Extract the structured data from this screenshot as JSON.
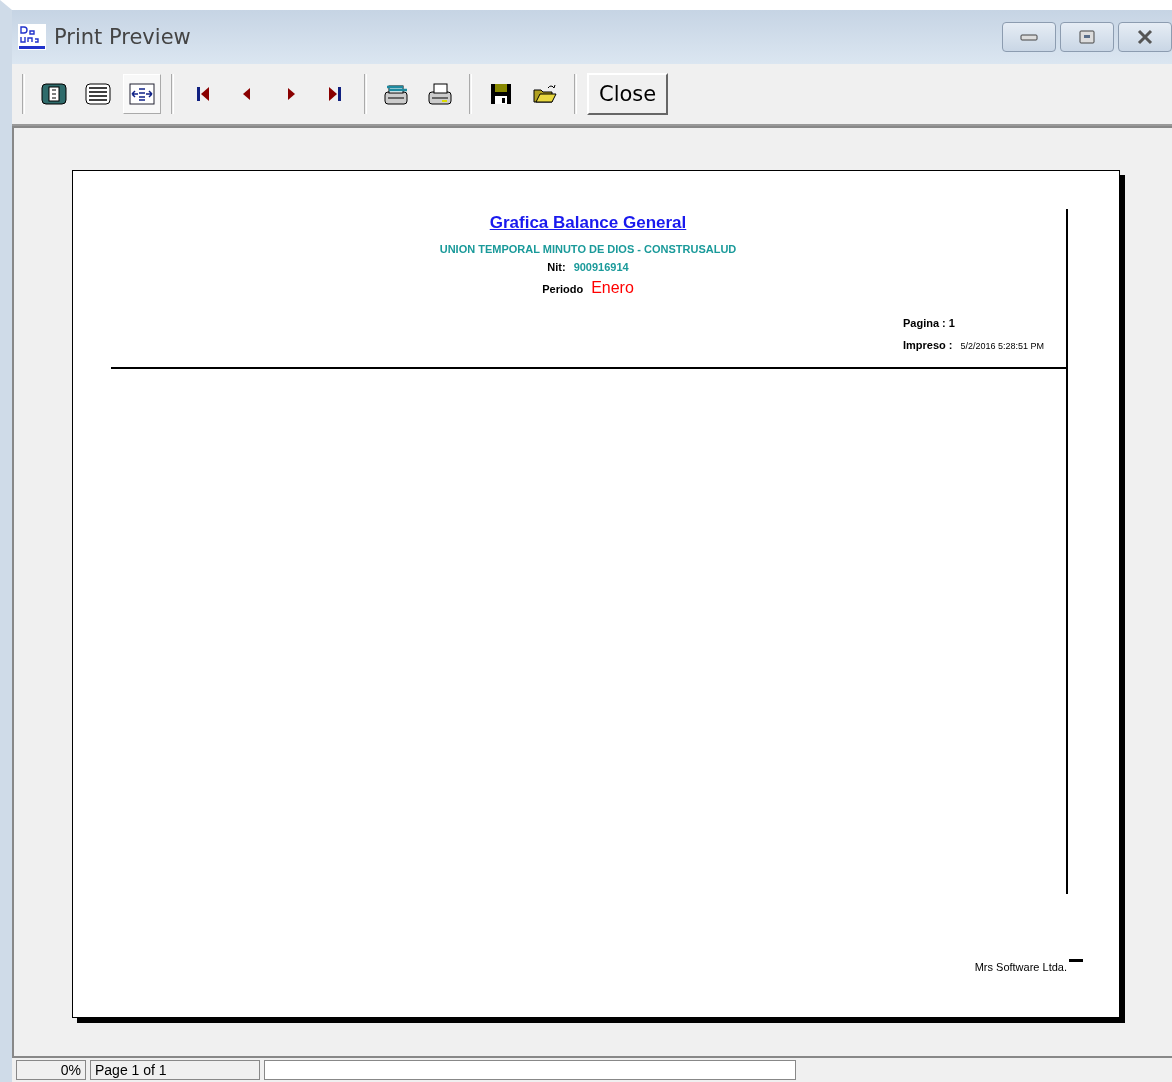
{
  "window": {
    "title": "Print Preview"
  },
  "toolbar": [
    {
      "kind": "icon",
      "selected": false
    },
    {
      "kind": "icon",
      "selected": false
    },
    {
      "kind": "icon",
      "selected": true
    },
    {
      "kind": "sep"
    },
    {
      "kind": "icon"
    },
    {
      "kind": "icon"
    },
    {
      "kind": "icon"
    },
    {
      "kind": "icon"
    },
    {
      "kind": "sep"
    },
    {
      "kind": "icon"
    },
    {
      "kind": "icon"
    },
    {
      "kind": "sep"
    },
    {
      "kind": "icon"
    },
    {
      "kind": "icon"
    },
    {
      "kind": "sep"
    },
    {
      "kind": "text",
      "label": "Close"
    }
  ],
  "report": {
    "title": "Grafica Balance General",
    "company": "UNION TEMPORAL MINUTO DE DIOS - CONSTRUSALUD",
    "nit_label": "Nit:",
    "nit": "900916914",
    "period_label": "Periodo",
    "period": "Enero",
    "page_label": "Pagina : 1",
    "printed_label": "Impreso :",
    "printed": "5/2/2016 5:28:51 PM",
    "footer": "Mrs Software Ltda."
  },
  "status_bar": {
    "zoom": "0%",
    "page": "Page 1 of 1",
    "progress": {
      "level": 0
    }
  }
}
